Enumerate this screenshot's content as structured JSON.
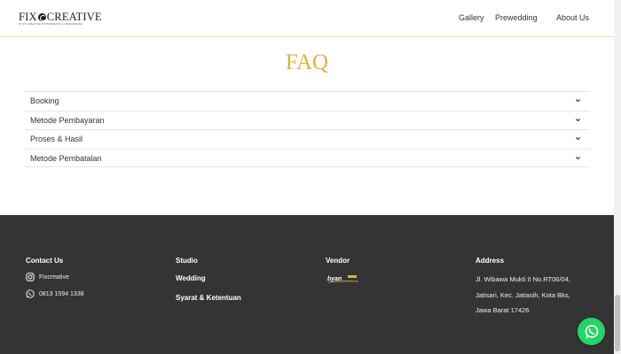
{
  "header": {
    "logo_text_left": "FIX",
    "logo_text_right": "CREATIVE",
    "logo_tagline": "BY FIX CREATIVE PHOTOGRAPHY & VIDEOGRAPHY",
    "nav": [
      "Gallery",
      "Prewedding",
      "About Us"
    ]
  },
  "faq": {
    "title": "FAQ",
    "items": [
      "Booking",
      "Metode Pembayaran",
      "Proses & Hasil",
      "Metode Pembatalan"
    ]
  },
  "footer": {
    "contact": {
      "heading": "Contact Us",
      "instagram": "Fixcreative",
      "phone": "0813 1594 1338"
    },
    "studio": {
      "heading": "Studio",
      "links": [
        "Wedding",
        "Syarat & Ketentuan"
      ]
    },
    "vendor": {
      "heading": "Vendor",
      "logo_text": "byan"
    },
    "address": {
      "heading": "Address",
      "lines": [
        "Jl. Wibawa Mukti II No.RT06/04,",
        "Jatisari, Kec. Jatiasih, Kota Bks,",
        "Jawa Barat 17426"
      ]
    }
  },
  "colors": {
    "accent_gold": "#d7b545",
    "footer_bg": "#343434",
    "whatsapp_green": "#25d366"
  }
}
